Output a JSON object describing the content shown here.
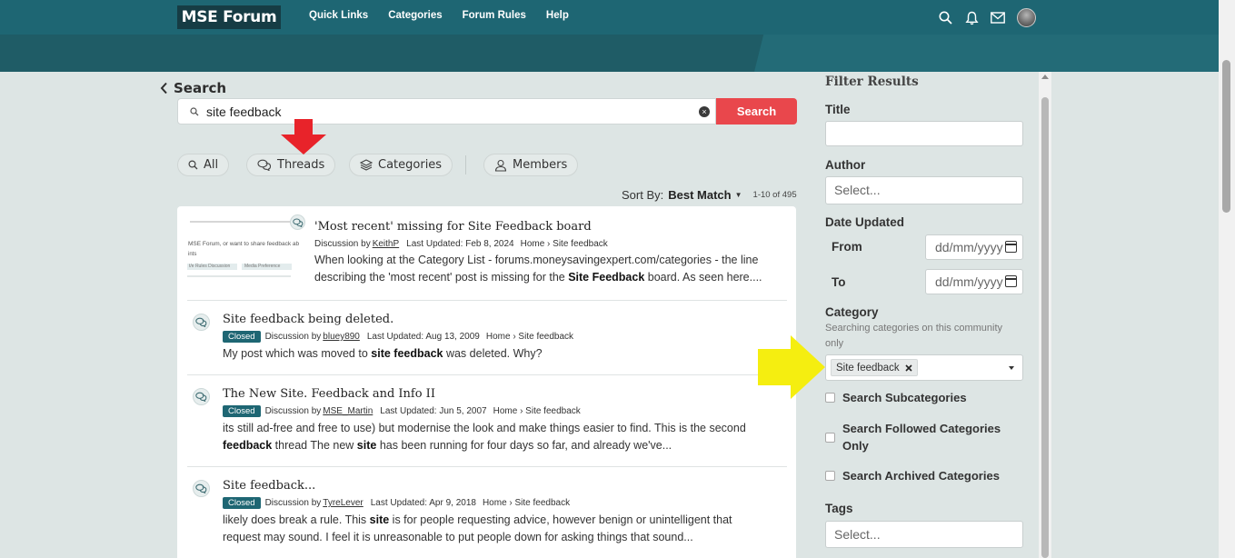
{
  "header": {
    "logo": "MSE Forum",
    "nav": [
      "Quick Links",
      "Categories",
      "Forum Rules",
      "Help"
    ],
    "icons": [
      "search-icon",
      "bell-icon",
      "mail-icon",
      "user-avatar"
    ]
  },
  "search": {
    "back_label": "Search",
    "query": "site feedback",
    "button_label": "Search",
    "tabs": [
      {
        "label": "All",
        "icon": "search-icon"
      },
      {
        "label": "Threads",
        "icon": "chat-icon"
      },
      {
        "label": "Categories",
        "icon": "layers-icon"
      },
      {
        "label": "Members",
        "icon": "user-icon"
      }
    ],
    "sort_label": "Sort By:",
    "sort_value": "Best Match",
    "result_count": "1-10 of 495"
  },
  "results": [
    {
      "title": "'Most recent' missing for Site Feedback board",
      "type": "Discussion by",
      "author": "KeithP",
      "updated": "Last Updated: Feb 8, 2024",
      "breadcrumb": "Home › Site feedback",
      "excerpt_parts": [
        "When looking at the Category List - forums.moneysavingexpert.com/categories - the line describing the 'most recent' post is missing for the ",
        "Site Feedback",
        " board. As seen here...."
      ],
      "thumbnail_text": "MSE Forum, or want to share feedback ab",
      "thumbnail_sub": "ints",
      "thumbnail_pill1": "t/e Rules Discussion",
      "thumbnail_pill2": "Media Preference"
    },
    {
      "title": "Site feedback being deleted.",
      "status": "Closed",
      "type": "Discussion by",
      "author": "bluey890",
      "updated": "Last Updated: Aug 13, 2009",
      "breadcrumb": "Home › Site feedback",
      "excerpt_parts": [
        "My post which was moved to ",
        "site feedback",
        " was deleted. Why?"
      ]
    },
    {
      "title": "The New Site. Feedback and Info II",
      "status": "Closed",
      "type": "Discussion by",
      "author": "MSE_Martin",
      "updated": "Last Updated: Jun 5, 2007",
      "breadcrumb": "Home › Site feedback",
      "excerpt_parts": [
        "its still ad-free and free to use) but modernise the look and make things easier to find. This is the second ",
        "feedback",
        " thread The new ",
        "site",
        " has been running for four days so far, and already we've..."
      ]
    },
    {
      "title": "Site feedback...",
      "status": "Closed",
      "type": "Discussion by",
      "author": "TyreLever",
      "updated": "Last Updated: Apr 9, 2018",
      "breadcrumb": "Home › Site feedback",
      "excerpt_parts": [
        "likely does break a rule. This ",
        "site",
        " is for people requesting advice, however benign or unintelligent that request may sound. I feel it is unreasonable to put people down for asking things that sound..."
      ]
    }
  ],
  "filters": {
    "heading": "Filter Results",
    "title_label": "Title",
    "author_label": "Author",
    "author_placeholder": "Select...",
    "date_label": "Date Updated",
    "from_label": "From",
    "to_label": "To",
    "date_placeholder": "dd/mm/yyyy",
    "category_label": "Category",
    "category_note": "Searching categories on this community only",
    "category_chip": "Site feedback",
    "check_subcategories": "Search Subcategories",
    "check_followed": "Search Followed Categories Only",
    "check_archived": "Search Archived Categories",
    "tags_label": "Tags",
    "tags_placeholder": "Select..."
  },
  "colors": {
    "header": "#1e6673",
    "search_button": "#e9474c",
    "badge": "#1e6673",
    "annotation_red": "#e8232a",
    "annotation_yellow": "#f5ee10"
  }
}
